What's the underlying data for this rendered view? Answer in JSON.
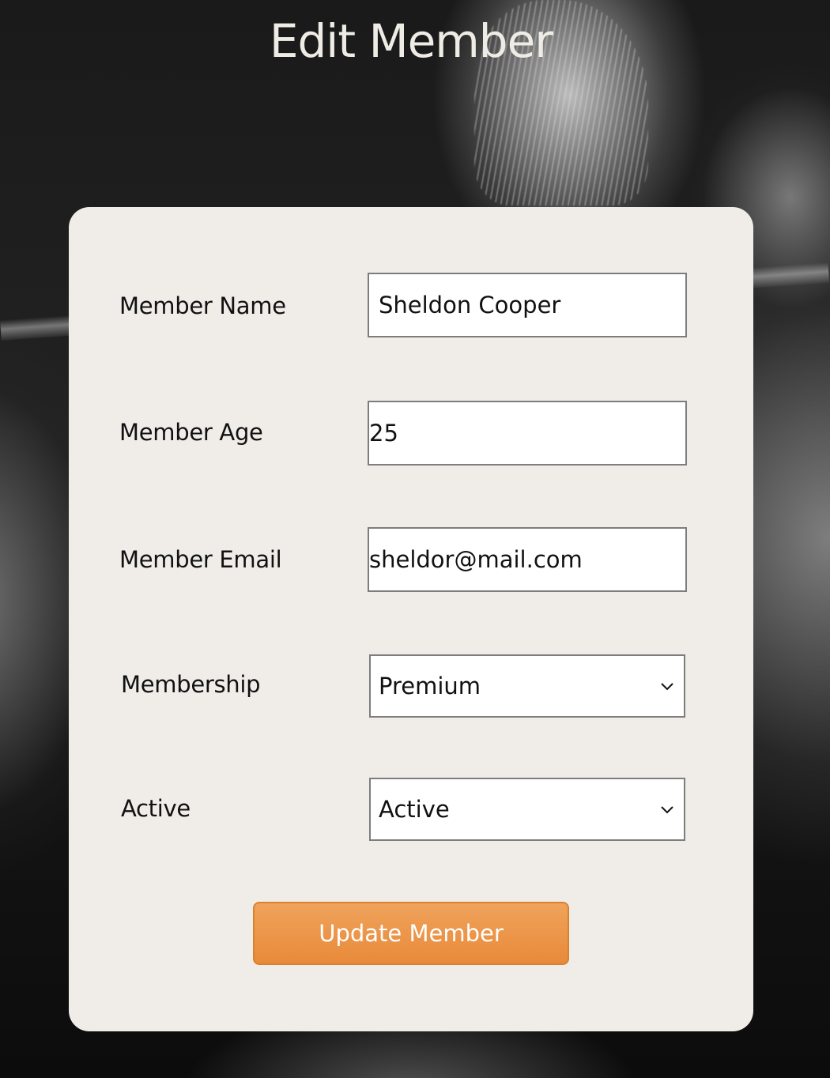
{
  "page": {
    "title": "Edit Member"
  },
  "form": {
    "fields": [
      {
        "label": "Member Name",
        "value": "Sheldon Cooper"
      },
      {
        "label": "Member Age",
        "value": "25"
      },
      {
        "label": "Member Email",
        "value": "sheldor@mail.com"
      }
    ],
    "membership": {
      "label": "Membership",
      "selected": "Premium"
    },
    "active": {
      "label": "Active",
      "selected": "Active"
    },
    "submit_label": "Update Member"
  },
  "icons": {
    "select_chevron": "chevron-down-icon"
  },
  "colors": {
    "card_background": "#f0ede9",
    "button_accent": "#e88a3a",
    "title_color": "#efece6"
  }
}
